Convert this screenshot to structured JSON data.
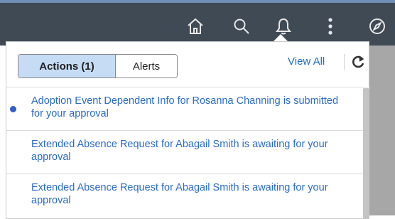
{
  "topbar": {
    "icons": [
      "home-icon",
      "search-icon",
      "bell-icon",
      "more-vertical-icon",
      "compass-icon"
    ]
  },
  "panel": {
    "tabs": [
      {
        "label": "Actions (1)",
        "active": true
      },
      {
        "label": "Alerts",
        "active": false
      }
    ],
    "view_all": "View All",
    "refresh_icon": "refresh-icon",
    "items": [
      {
        "text": "Adoption Event Dependent Info for Rosanna Channing is submitted for your approval",
        "unread": true
      },
      {
        "text": "Extended Absence Request for Abagail Smith is awaiting for your approval",
        "unread": false
      },
      {
        "text": "Extended Absence Request for Abagail Smith is awaiting for your approval",
        "unread": false
      }
    ]
  },
  "colors": {
    "topbar": "#3f4a55",
    "link": "#2a6cc4",
    "active_tab": "#c6dcf5",
    "unread_dot": "#2d5ec9"
  }
}
